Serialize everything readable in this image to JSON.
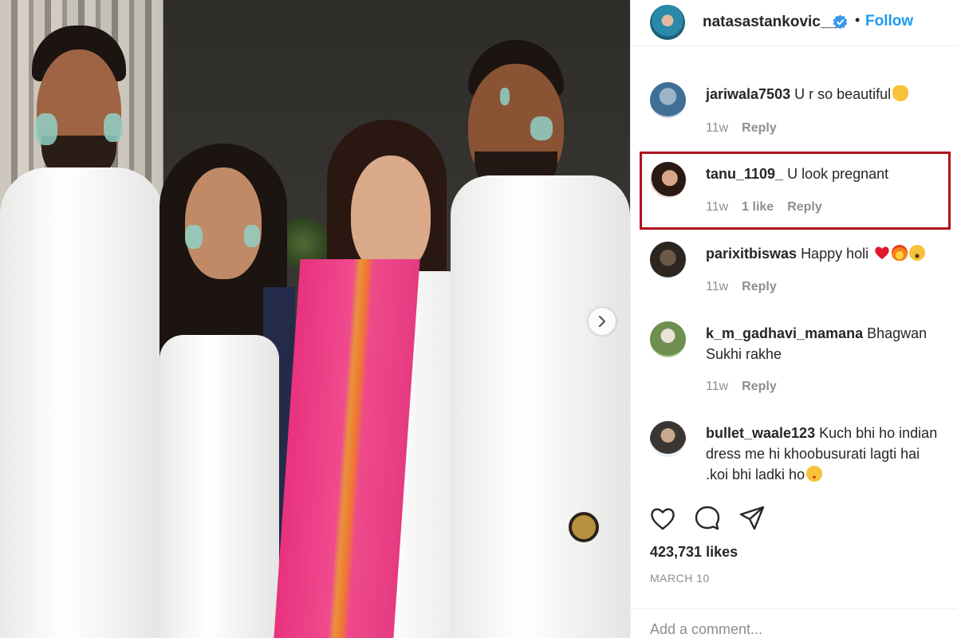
{
  "post": {
    "author": "natasastankovic__",
    "separator": "•",
    "follow_label": "Follow",
    "likes": "423,731 likes",
    "date": "MARCH 10",
    "add_comment_placeholder": "Add a comment..."
  },
  "comments": [
    {
      "user": "jariwala7503",
      "text": "U r so beautiful",
      "emoji": "ok-hand",
      "time": "11w",
      "likes": "",
      "reply": "Reply"
    },
    {
      "user": "tanu_1109_",
      "text": "U look pregnant",
      "emoji": "",
      "time": "11w",
      "likes": "1 like",
      "reply": "Reply"
    },
    {
      "user": "parixitbiswas",
      "text": "Happy holi",
      "emoji": "heart fire astonished",
      "time": "11w",
      "likes": "",
      "reply": "Reply"
    },
    {
      "user": "k_m_gadhavi_mamana",
      "text": "Bhagwan Sukhi rakhe",
      "emoji": "",
      "time": "11w",
      "likes": "",
      "reply": "Reply"
    },
    {
      "user": "bullet_waale123",
      "text": "Kuch bhi ho indian dress me hi khoobusurati lagti hai .koi bhi ladki ho",
      "emoji": "smiling-face",
      "time": "",
      "likes": "",
      "reply": ""
    }
  ],
  "icons": {
    "like": "heart-icon",
    "comment": "comment-bubble-icon",
    "share": "paper-plane-icon",
    "next": "chevron-right-icon",
    "verified": "verified-badge-icon"
  },
  "colors": {
    "accent": "#1a9af0",
    "highlight": "#b1121d",
    "muted": "#8e8e8e"
  }
}
